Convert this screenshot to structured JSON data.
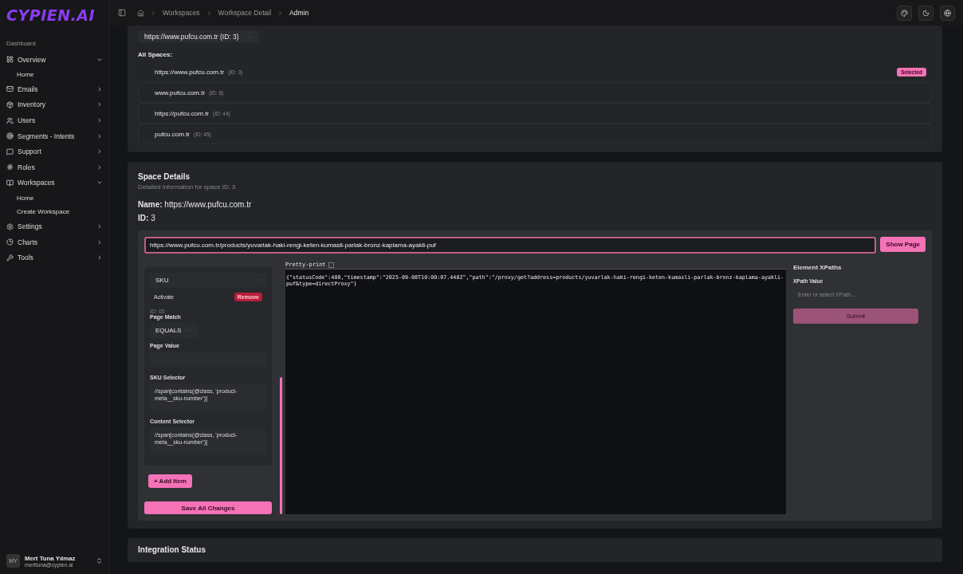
{
  "brand": {
    "logo": "CYPIEN.AI"
  },
  "sidebar": {
    "section": "Dashboard",
    "items": [
      {
        "label": "Overview",
        "expanded": true,
        "children": [
          {
            "label": "Home"
          }
        ]
      },
      {
        "label": "Emails",
        "expanded": false
      },
      {
        "label": "Inventory",
        "expanded": false
      },
      {
        "label": "Users",
        "expanded": false
      },
      {
        "label": "Segments - Intents",
        "expanded": false
      },
      {
        "label": "Support",
        "expanded": false
      },
      {
        "label": "Roles",
        "expanded": false
      },
      {
        "label": "Workspaces",
        "expanded": true,
        "children": [
          {
            "label": "Home"
          },
          {
            "label": "Create Workspace"
          }
        ]
      },
      {
        "label": "Settings",
        "expanded": false
      },
      {
        "label": "Charts",
        "expanded": false
      },
      {
        "label": "Tools",
        "expanded": false
      }
    ],
    "user": {
      "initials": "MY",
      "name": "Mert Tuna Yılmaz",
      "email": "merttuna@cypien.ai"
    }
  },
  "breadcrumbs": [
    "Workspaces",
    "Workspace Detail",
    "Admin"
  ],
  "space_select": {
    "value": "https://www.pufcu.com.tr (ID: 3)"
  },
  "all_spaces": {
    "title": "All Spaces:",
    "badge": "Selected",
    "items": [
      {
        "name": "https://www.pufcu.com.tr",
        "id": "(ID: 3)",
        "selected": true
      },
      {
        "name": "www.pufcu.com.tr",
        "id": "(ID: 6)",
        "selected": false
      },
      {
        "name": "https://pufcu.com.tr",
        "id": "(ID: 44)",
        "selected": false
      },
      {
        "name": "pufcu.com.tr",
        "id": "(ID: 45)",
        "selected": false
      }
    ]
  },
  "space_details": {
    "title": "Space Details",
    "subtitle": "Detailed information for space ID: 3",
    "name_label": "Name:",
    "name": "https://www.pufcu.com.tr",
    "id_label": "ID:",
    "id": "3",
    "url": "https://www.pufcu.com.tr/products/yuvarlak-haki-rengi-keten-kumasli-parlak-bronz-kaplama-ayakli-puf",
    "show_page": "Show Page",
    "item": {
      "type": "SKU",
      "activate": "Activate",
      "remove": "Remove",
      "id": "ID: 65",
      "page_match_label": "Page Match",
      "page_match": "EQUALS",
      "page_value_label": "Page Value",
      "sku_selector_label": "SKU Selector",
      "sku_selector": "//span[contains(@class, 'product-meta__sku-number')]",
      "content_selector_label": "Content Selector",
      "content_selector": "//span[contains(@class, 'product-meta__sku-number')]"
    },
    "add_item": "+ Add Item",
    "save": "Save All Changes",
    "pretty_print": {
      "label": "Pretty-print",
      "checked": false
    },
    "response": "{\"statusCode\":400,\"timestamp\":\"2025-09-08T10:00:07.448Z\",\"path\":\"/proxy/get?address=products/yuvarlak-haki-rengi-keten-kumasli-parlak-bronz-kaplama-ayakli-puf&type=directProxy\"}",
    "xpaths": {
      "title": "Element XPaths",
      "label": "XPath Value",
      "placeholder": "Enter or select XPath...",
      "submit": "Submit"
    }
  },
  "integration": {
    "title": "Integration Status"
  }
}
